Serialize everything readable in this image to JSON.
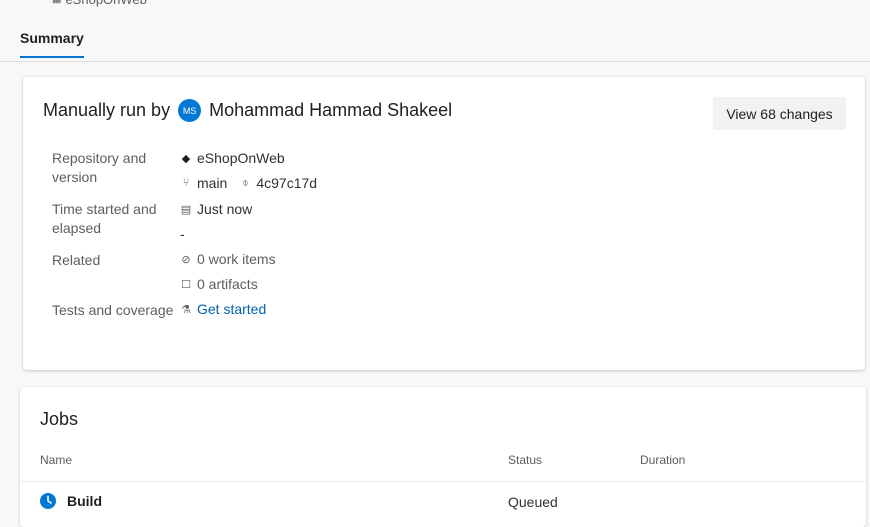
{
  "breadcrumb": {
    "repo": "eShopOnWeb"
  },
  "tabs": [
    {
      "label": "Summary"
    }
  ],
  "summary": {
    "title_prefix": "Manually run by",
    "avatar_initials": "MS",
    "user": "Mohammad Hammad Shakeel",
    "changes_button": "View 68 changes",
    "rows": {
      "repo_label": "Repository and version",
      "repo_name": "eShopOnWeb",
      "branch": "main",
      "commit": "4c97c17d",
      "time_label": "Time started and elapsed",
      "time_started": "Just now",
      "elapsed": "-",
      "related_label": "Related",
      "work_items": "0 work items",
      "artifacts": "0 artifacts",
      "tests_label": "Tests and coverage",
      "tests_link": "Get started"
    }
  },
  "jobs": {
    "title": "Jobs",
    "columns": [
      "Name",
      "Status",
      "Duration"
    ],
    "rows": [
      {
        "name": "Build",
        "status": "Queued",
        "duration": ""
      }
    ]
  },
  "colors": {
    "accent": "#0078d4",
    "link": "#0062ad"
  },
  "icons": [
    "repo-icon",
    "git-branch-icon",
    "commit-icon",
    "calendar-icon",
    "work-item-icon",
    "artifact-icon",
    "flask-icon",
    "clock-icon"
  ]
}
